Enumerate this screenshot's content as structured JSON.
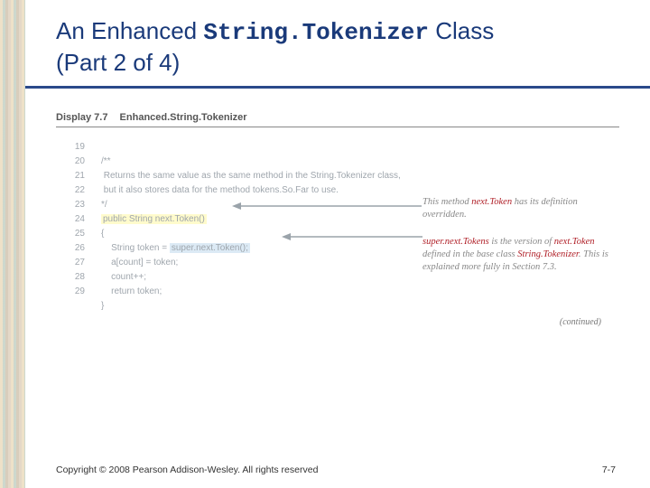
{
  "title": {
    "prefix": "An Enhanced ",
    "codeword": "String.Tokenizer",
    "suffix": " Class",
    "line2": "(Part 2 of 4)"
  },
  "display": {
    "label": "Display 7.7",
    "name": "Enhanced.String.Tokenizer"
  },
  "lineNumbers": [
    "19",
    "20",
    "21",
    "22",
    "23",
    "24",
    "25",
    "26",
    "27",
    "28",
    "29"
  ],
  "code": {
    "l19": "/**",
    "l20": " Returns the same value as the same method in the String.Tokenizer class,",
    "l21": " but it also stores data for the method tokens.So.Far to use.",
    "l22": "*/",
    "l23a": "public String next.Token()",
    "l24": "{",
    "l25a": "    String token = ",
    "l25b": "super.next.Token();",
    "l26": "    a[count] = token;",
    "l27": "    count++;",
    "l28": "    return token;",
    "l29": "}"
  },
  "annotations": {
    "a1_pre": "This method ",
    "a1_mono": "next.Token",
    "a1_post": " has its definition overridden.",
    "a2_mono1": "super.next.Tokens",
    "a2_mid1": " is the version of ",
    "a2_mono2": "next.Token",
    "a2_mid2": " defined in the base class ",
    "a2_mono3": "String.Tokenizer",
    "a2_end": ". This is explained more fully in Section 7.3."
  },
  "continued": "(continued)",
  "footer": {
    "left": "Copyright © 2008 Pearson Addison-Wesley. All rights reserved",
    "right": "7-7"
  }
}
